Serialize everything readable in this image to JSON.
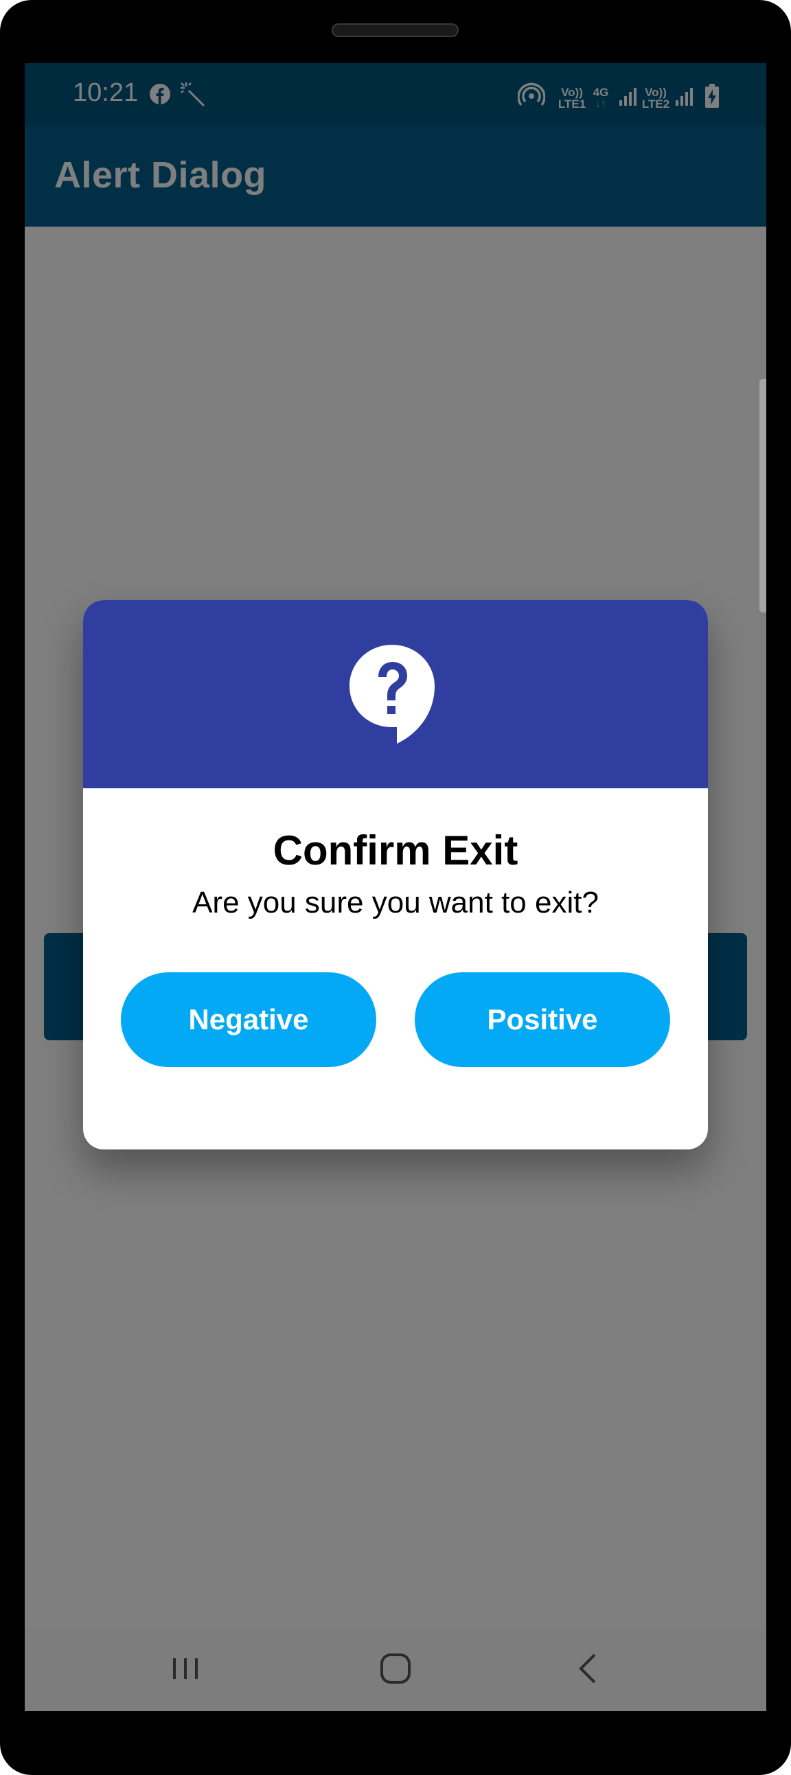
{
  "status_bar": {
    "time": "10:21",
    "icons": [
      "facebook-icon",
      "magic-wand-icon",
      "hotspot-icon",
      "volte-lte1-icon",
      "4g-data-icon",
      "signal-icon",
      "volte-lte2-icon",
      "signal-icon",
      "battery-charging-icon"
    ],
    "volte1_top": "Vo))",
    "volte1_bottom": "LTE1",
    "network_type": "4G",
    "volte2_top": "Vo))",
    "volte2_bottom": "LTE2"
  },
  "app_bar": {
    "title": "Alert Dialog"
  },
  "dialog": {
    "icon": "question-bubble-icon",
    "title": "Confirm Exit",
    "message": "Are you sure you want to exit?",
    "negative_label": "Negative",
    "positive_label": "Positive"
  },
  "nav_bar": {
    "items": [
      "recents-icon",
      "home-icon",
      "back-icon"
    ]
  },
  "colors": {
    "status_bar": "#01567f",
    "app_bar": "#015f8c",
    "dialog_header": "#303f9f",
    "dialog_button": "#03a9f4"
  }
}
